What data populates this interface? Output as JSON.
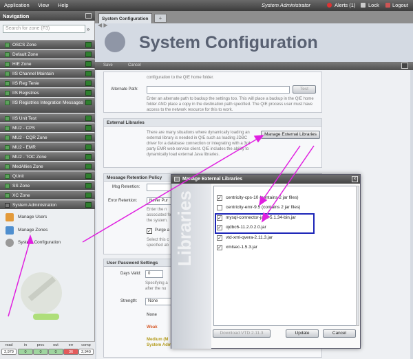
{
  "menubar": {
    "application": "Application",
    "view": "View",
    "help": "Help",
    "user": "System Administrator",
    "alerts": "Alerts (1)",
    "lock": "Lock",
    "logout": "Logout"
  },
  "nav": {
    "header": "Navigation",
    "search_placeholder": "Search for zone (F3)",
    "items": [
      "OSCS Zone",
      "Default Zone",
      "HIE Zone",
      "IIS Channel Maintain",
      "IIS Reg Tenie",
      "IIS Registries",
      "IIS Registries Integration Messages",
      "IIS Unit Test",
      "MU2 - CPS",
      "MU2 - CQR Zone",
      "MU2 - EMR",
      "MU2 - TOC Zone",
      "MedAllies Zone",
      "QUnit",
      "SS Zone",
      "XC Zone",
      "System Administration"
    ],
    "sub_items": [
      "Manage Users",
      "Manage Zones",
      "System Configuration"
    ]
  },
  "stats": {
    "labels": [
      "read",
      "in",
      "proc",
      "out",
      "err",
      "comp"
    ],
    "values": [
      "2,979",
      "0",
      "0",
      "0",
      "36",
      "2,940"
    ]
  },
  "tabs": {
    "active": "System Configuration"
  },
  "header": {
    "title": "System Configuration"
  },
  "toolbar": {
    "save": "Save",
    "cancel": "Cancel"
  },
  "form": {
    "intro_text": "configuration to the QIE home folder.",
    "alt_path_label": "Alternate Path:",
    "alt_path_value": "",
    "test_button": "Test",
    "alt_path_desc": "Enter an alternate path to backup the settings too. This will place a backup in the QIE home folder AND place a copy in the destination path specified. The QIE process user must have access to the network resource for this to work.",
    "ext_lib_title": "External Libraries",
    "ext_lib_desc": "There are many situations where dynamically loading an external library is needed in QIE such as loading JDBC driver for a database connection or integrating with a 3rd party EMR web service client. QIE includes the ability to dynamically load external Java libraries.",
    "manage_button": "Manage External Libraries",
    "retention_title": "Message Retention Policy",
    "msg_retention_label": "Msg Retention:",
    "err_retention_label": "Error Retention:",
    "err_retention_value": "Never Pur",
    "retention_desc": "Enter the n associated fe the system.",
    "purge_label": "Purge a",
    "purge_desc": "Select this c specified ab",
    "pwd_title": "User Password Settings",
    "days_valid_label": "Days Valid:",
    "days_valid_value": "0",
    "days_valid_desc": "Specifying a after the nu",
    "strength_label": "Strength:",
    "strength_value": "None",
    "strength_levels": [
      "None",
      "Weak",
      "Medium (M",
      "System Adm"
    ]
  },
  "dialog": {
    "title": "Manage External Libraries",
    "side_text": "Libraries",
    "libraries": [
      {
        "name": "centricity-cps-10 (contains 2 jar files)",
        "checked": true
      },
      {
        "name": "centricity-emr-9.5 (contains 2 jar files)",
        "checked": false
      },
      {
        "name": "mysql-connector-java-5.1.34-bin.jar",
        "checked": true
      },
      {
        "name": "ojdbc6-11.2.0.2.0.jar",
        "checked": true
      },
      {
        "name": "vtd-xml-qvera-2.11.3.jar",
        "checked": true
      },
      {
        "name": "xmlsec-1.5.3.jar",
        "checked": true
      }
    ],
    "download_button": "Download VTD 2.11.3",
    "update_button": "Update",
    "cancel_button": "Cancel"
  },
  "colors": {
    "arrow": "#e020e0",
    "highlight": "#1c25b8"
  }
}
